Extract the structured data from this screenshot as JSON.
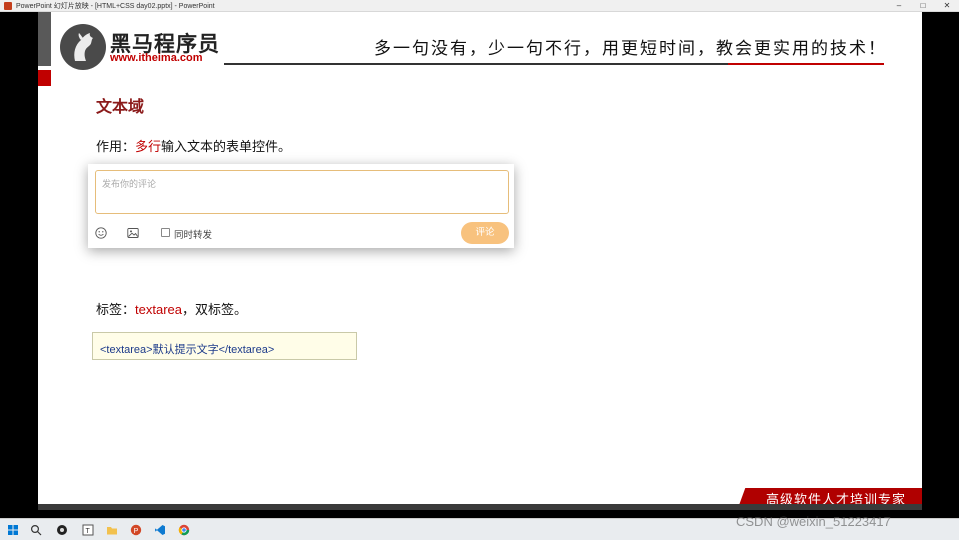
{
  "window": {
    "title": "PowerPoint 幻灯片放映 - [HTML+CSS day02.pptx] - PowerPoint",
    "minimize": "–",
    "maximize": "□",
    "close": "✕"
  },
  "header": {
    "brand_name": "黑马程序员",
    "brand_url": "www.itheima.com",
    "slogan": "多一句没有，少一句不行，用更短时间，教会更实用的技术！"
  },
  "content": {
    "heading": "文本域",
    "purpose_prefix": "作用：",
    "purpose_accent": "多行",
    "purpose_suffix": "输入文本的表单控件。",
    "tag_prefix": "标签：",
    "tag_accent": "textarea",
    "tag_suffix": "，双标签。",
    "code_sample": "<textarea>默认提示文字</textarea>"
  },
  "comment_widget": {
    "placeholder": "发布你的评论",
    "emoji_icon": "smile-icon",
    "image_icon": "image-icon",
    "repost_label": "同时转发",
    "submit_label": "评论"
  },
  "footer": {
    "banner_text": "高级软件人才培训专家",
    "watermark": "CSDN @weixin_51223417"
  },
  "colors": {
    "accent_red": "#c00000",
    "heading_red": "#8b1a1a",
    "button_orange": "#f8c27e",
    "textarea_border": "#e6bd7a",
    "code_text": "#1c3a8a"
  }
}
